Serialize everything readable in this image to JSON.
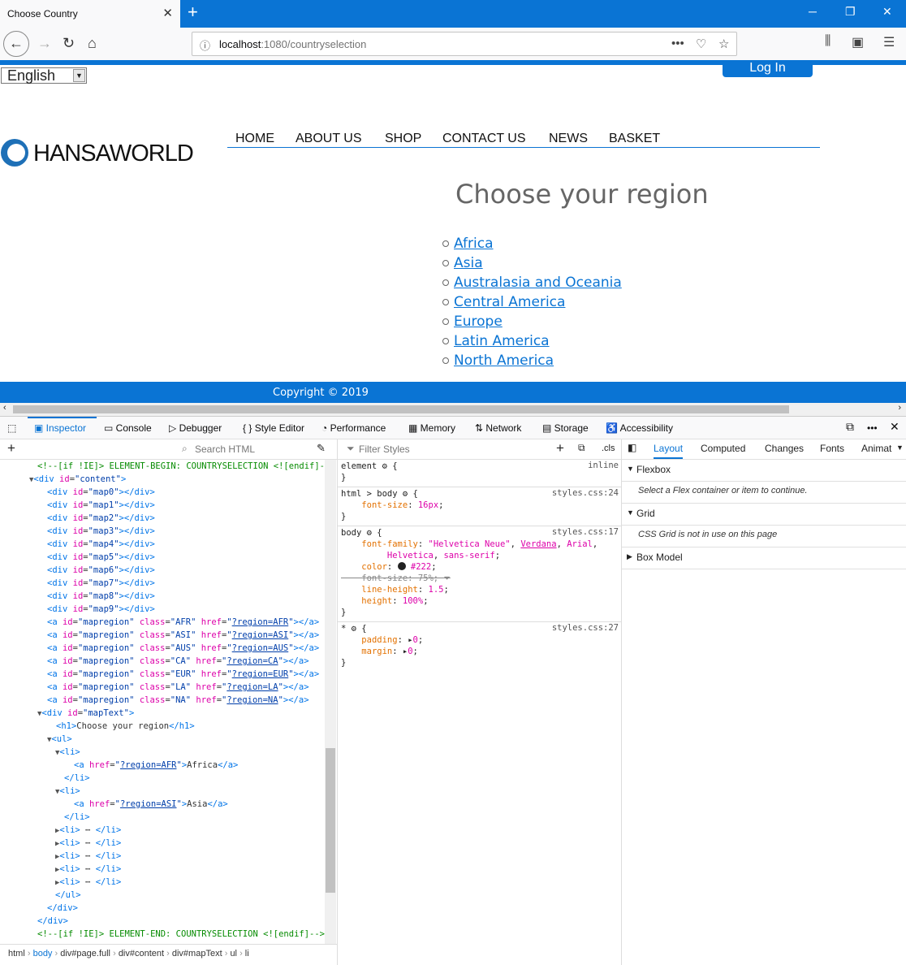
{
  "browser": {
    "tab_title": "Choose Country",
    "url_host": "localhost",
    "url_path": ":1080/countryselection"
  },
  "page": {
    "language": "English",
    "login": "Log In",
    "logo": "HANSAWORLD",
    "nav": [
      "HOME",
      "ABOUT US",
      "SHOP",
      "CONTACT US",
      "NEWS",
      "BASKET"
    ],
    "heading": "Choose your region",
    "regions": [
      "Africa",
      "Asia",
      "Australasia and Oceania",
      "Central America",
      "Europe",
      "Latin America",
      "North America"
    ],
    "footer": "Copyright © 2019"
  },
  "devtools": {
    "tabs": [
      "Inspector",
      "Console",
      "Debugger",
      "Style Editor",
      "Performance",
      "Memory",
      "Network",
      "Storage",
      "Accessibility"
    ],
    "search_placeholder": "Search HTML",
    "filter_placeholder": "Filter Styles",
    "cls": ".cls",
    "side_tabs": [
      "Layout",
      "Computed",
      "Changes",
      "Fonts",
      "Animat"
    ],
    "layout": {
      "flexbox": "Flexbox",
      "flexbox_note": "Select a Flex container or item to continue.",
      "grid": "Grid",
      "grid_note": "CSS Grid is not in use on this page",
      "boxmodel": "Box Model"
    },
    "breadcrumbs": [
      "html",
      "body",
      "div#page.full",
      "div#content",
      "div#mapText",
      "ul",
      "li"
    ]
  }
}
